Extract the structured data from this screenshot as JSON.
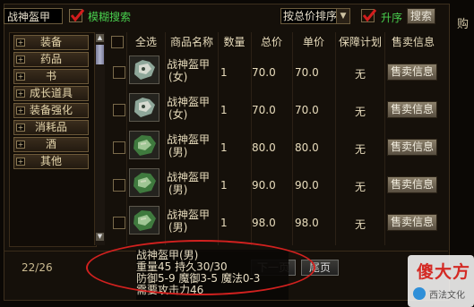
{
  "top": {
    "search_value": "战神盔甲",
    "fuzzy_label": "模糊搜索",
    "sort_value": "按总价排序",
    "asc_label": "升序",
    "search_button": "搜索",
    "right_cut_text": "购"
  },
  "categories": [
    {
      "label": "装备"
    },
    {
      "label": "药品"
    },
    {
      "label": "书"
    },
    {
      "label": "成长道具"
    },
    {
      "label": "装备强化"
    },
    {
      "label": "消耗品"
    },
    {
      "label": "酒"
    },
    {
      "label": "其他"
    }
  ],
  "table": {
    "headers": {
      "select_all": "全选",
      "name": "商品名称",
      "qty": "数量",
      "total": "总价",
      "unit": "单价",
      "guarantee": "保障计划",
      "sell_info": "售卖信息"
    },
    "rows": [
      {
        "name1": "战神盔甲",
        "name2": "(女)",
        "qty": "1",
        "total": "70.0",
        "unit": "70.0",
        "guarantee": "无",
        "sell": "售卖信息",
        "icon": "armor-female-icon"
      },
      {
        "name1": "战神盔甲",
        "name2": "(女)",
        "qty": "1",
        "total": "70.0",
        "unit": "70.0",
        "guarantee": "无",
        "sell": "售卖信息",
        "icon": "armor-female-icon"
      },
      {
        "name1": "战神盔甲",
        "name2": "(男)",
        "qty": "1",
        "total": "80.0",
        "unit": "80.0",
        "guarantee": "无",
        "sell": "售卖信息",
        "icon": "armor-male-icon"
      },
      {
        "name1": "战神盔甲",
        "name2": "(男)",
        "qty": "1",
        "total": "90.0",
        "unit": "90.0",
        "guarantee": "无",
        "sell": "售卖信息",
        "icon": "armor-male-icon"
      },
      {
        "name1": "战神盔甲",
        "name2": "(男)",
        "qty": "1",
        "total": "98.0",
        "unit": "98.0",
        "guarantee": "无",
        "sell": "售卖信息",
        "icon": "armor-male-icon"
      }
    ]
  },
  "bottom": {
    "page": "22/26",
    "next_page": "下一页",
    "last_page": "尾页"
  },
  "tooltip": {
    "line1": "战神盔甲(男)",
    "line2": "重量45  持久30/30",
    "line3": "防御5-9  魔御3-5  魔法0-3",
    "line4": "需要攻击力46"
  },
  "watermark": {
    "text": "傻大方",
    "sub": "西法文化"
  },
  "colors": {
    "accent_green": "#49d04e",
    "check_red": "#d21d1d",
    "annotation_red": "#d2211f"
  }
}
